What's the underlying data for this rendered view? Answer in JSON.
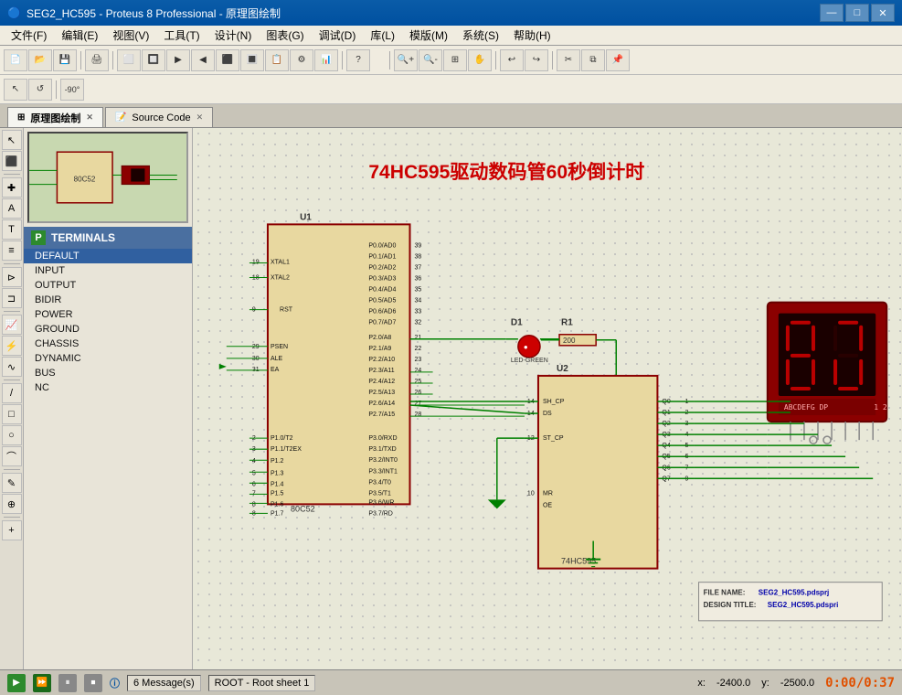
{
  "titlebar": {
    "title": "SEG2_HC595 - Proteus 8 Professional - 原理图绘制",
    "min": "—",
    "max": "□",
    "close": "✕"
  },
  "menubar": {
    "items": [
      "文件(F)",
      "编辑(E)",
      "视图(V)",
      "工具(T)",
      "设计(N)",
      "图表(G)",
      "调试(D)",
      "库(L)",
      "模版(M)",
      "系统(S)",
      "帮助(H)"
    ]
  },
  "tabs": [
    {
      "label": "原理图绘制",
      "icon": "schematic",
      "active": true
    },
    {
      "label": "Source Code",
      "icon": "code",
      "active": false
    }
  ],
  "panel": {
    "header": "TERMINALS",
    "p_icon": "P",
    "items": [
      "DEFAULT",
      "INPUT",
      "OUTPUT",
      "BIDIR",
      "POWER",
      "GROUND",
      "CHASSIS",
      "DYNAMIC",
      "BUS",
      "NC"
    ]
  },
  "circuit": {
    "title": "74HC595驱动数码管60秒倒计时",
    "u1_label": "U1",
    "u1_type": "80C52",
    "u2_label": "U2",
    "u2_type": "74HC595",
    "d1_label": "D1",
    "r1_label": "R1",
    "r1_value": "200"
  },
  "statusbar": {
    "messages": "6 Message(s)",
    "root": "ROOT - Root sheet 1",
    "x_label": "x:",
    "x_val": "-2400.0",
    "y_label": "y:",
    "y_val": "-2500.0",
    "timer": "0:00/0:37"
  },
  "file_info": {
    "file_name_label": "FILE NAME:",
    "file_name_val": "SEG2_HC595.pdsprj",
    "design_title_label": "DESIGN TITLE:",
    "design_title_val": "SEG2_HC595.pdspri"
  }
}
